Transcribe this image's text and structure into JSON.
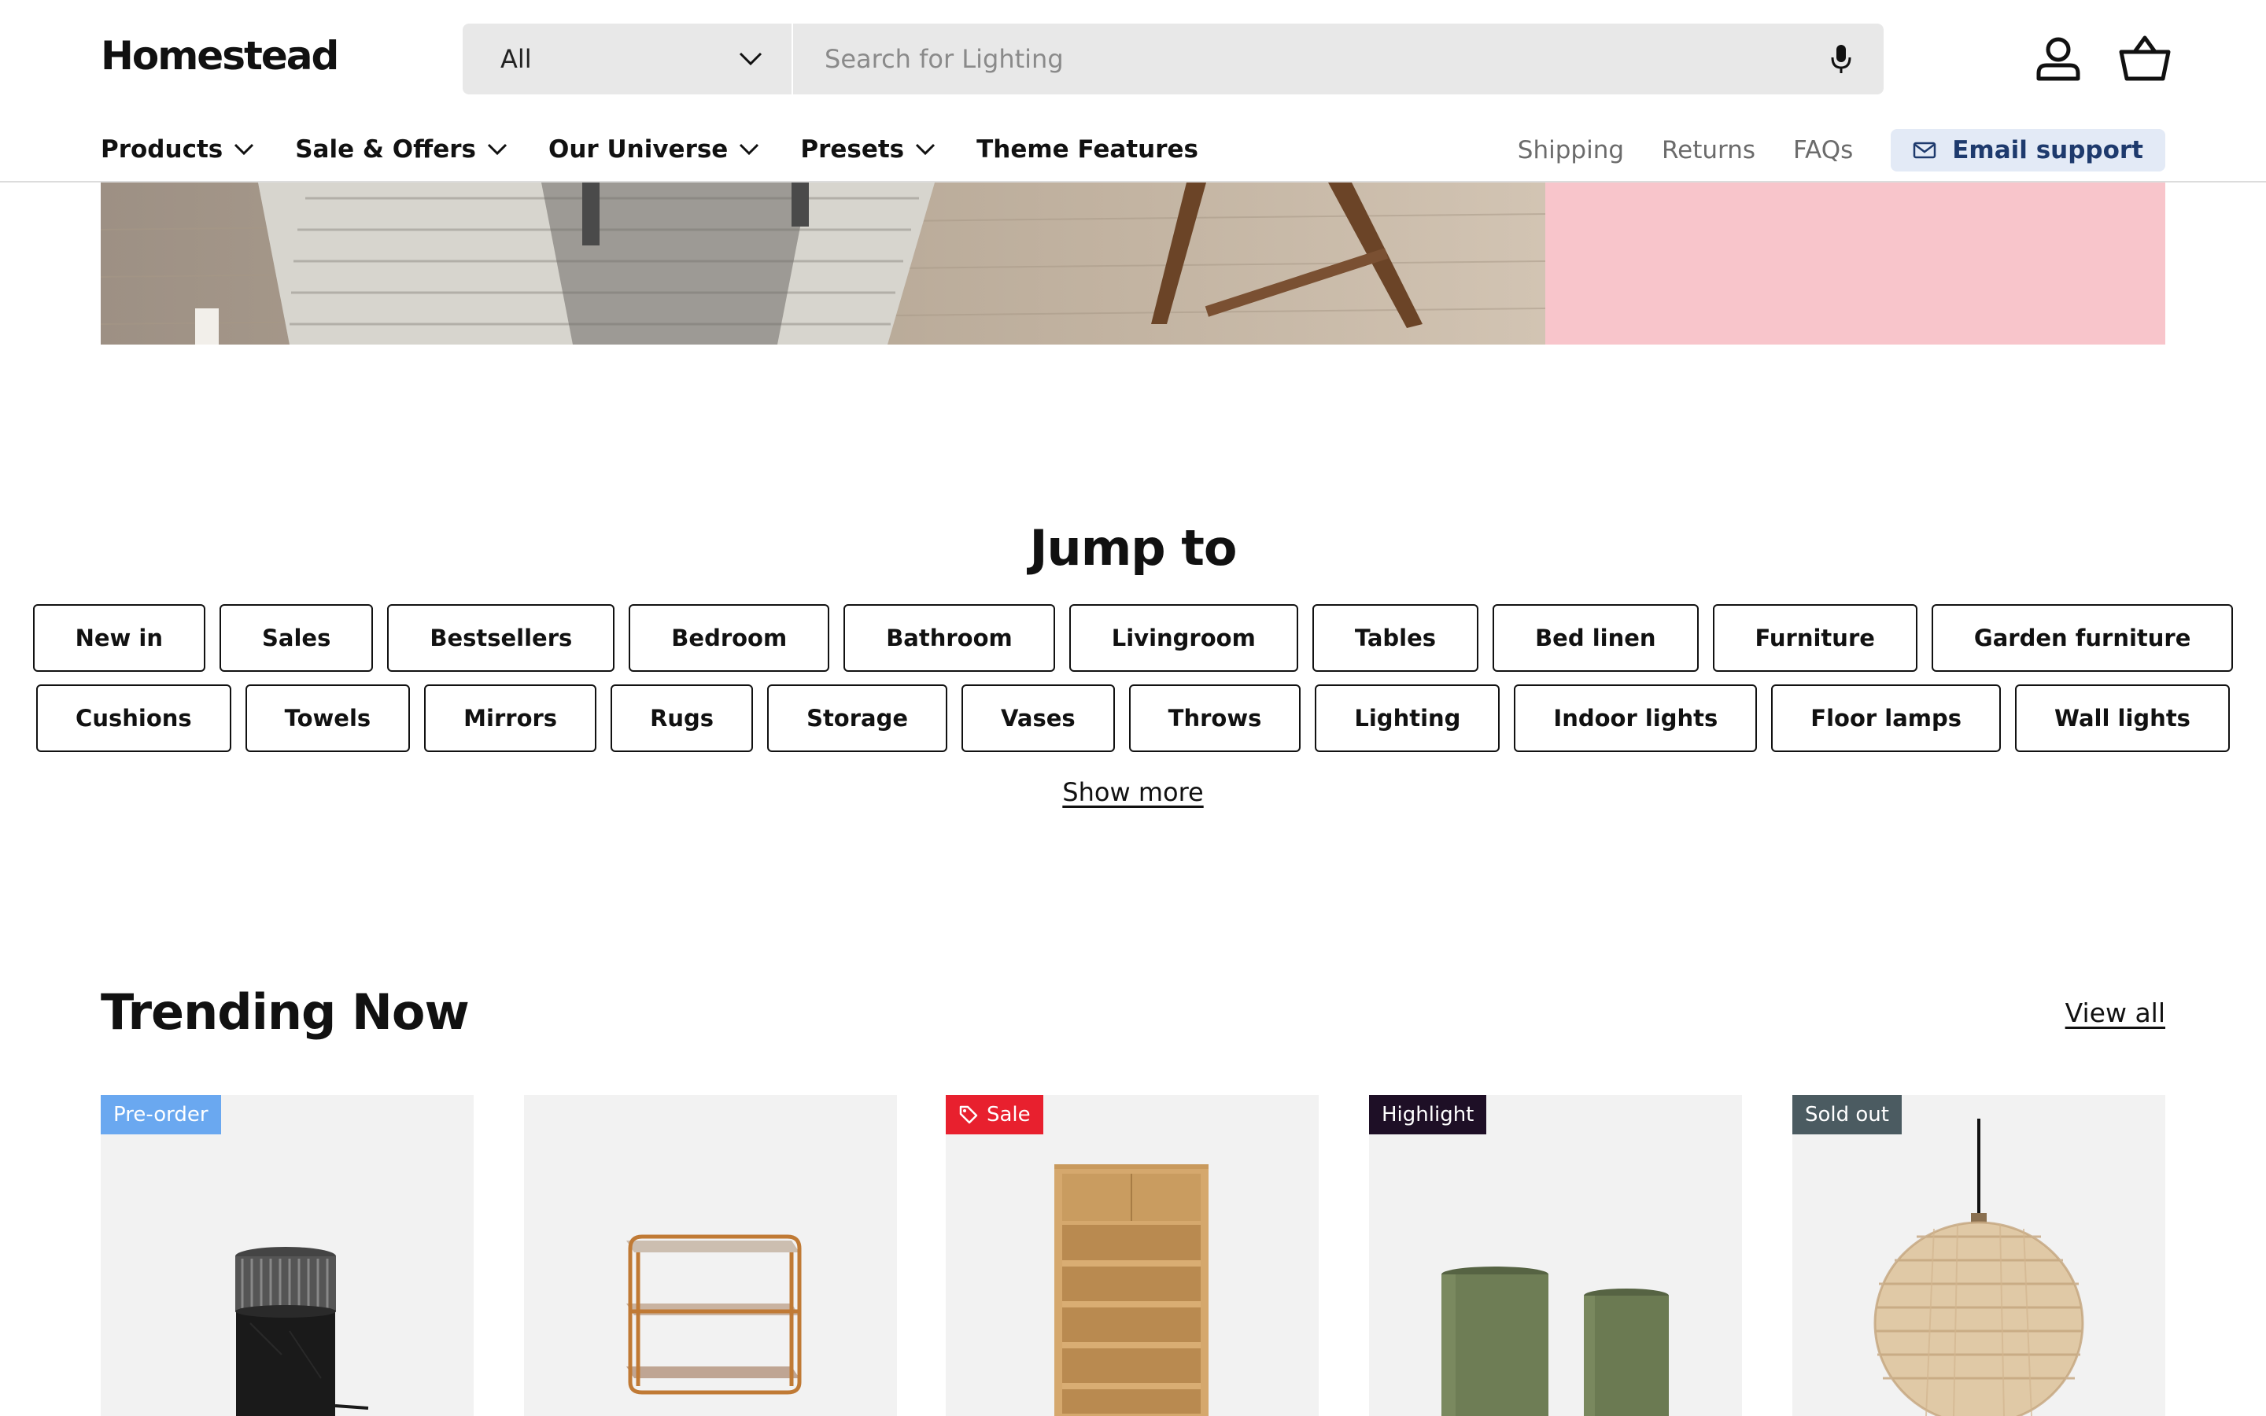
{
  "header": {
    "logo": "Homestead",
    "search": {
      "category": "All",
      "placeholder": "Search for Lighting"
    },
    "nav": [
      {
        "label": "Products",
        "has_dropdown": true
      },
      {
        "label": "Sale & Offers",
        "has_dropdown": true
      },
      {
        "label": "Our Universe",
        "has_dropdown": true
      },
      {
        "label": "Presets",
        "has_dropdown": true
      },
      {
        "label": "Theme Features",
        "has_dropdown": false
      }
    ],
    "util_links": [
      "Shipping",
      "Returns",
      "FAQs"
    ],
    "email_support": "Email support"
  },
  "jump": {
    "title": "Jump to",
    "row1": [
      "New in",
      "Sales",
      "Bestsellers",
      "Bedroom",
      "Bathroom",
      "Livingroom",
      "Tables",
      "Bed linen",
      "Furniture",
      "Garden furniture"
    ],
    "row2": [
      "Cushions",
      "Towels",
      "Mirrors",
      "Rugs",
      "Storage",
      "Vases",
      "Throws",
      "Lighting",
      "Indoor lights",
      "Floor lamps",
      "Wall lights"
    ],
    "show_more": "Show more"
  },
  "trending": {
    "title": "Trending Now",
    "view_all": "View all",
    "products": [
      {
        "badge": "Pre-order",
        "badge_color": "#6aa8f0",
        "image": "table-lamp"
      },
      {
        "badge": "",
        "badge_color": "",
        "image": "side-table"
      },
      {
        "badge": "Sale",
        "badge_color": "#e8202e",
        "badge_icon": "tag-icon",
        "image": "bookcase"
      },
      {
        "badge": "Highlight",
        "badge_color": "#1e0f26",
        "image": "vases"
      },
      {
        "badge": "Sold out",
        "badge_color": "#4b5b61",
        "image": "pendant-lamp"
      }
    ]
  },
  "colors": {
    "accent_pink": "#f8c5cb",
    "email_bg": "#e3eaf6",
    "email_text": "#1e3a6d"
  }
}
